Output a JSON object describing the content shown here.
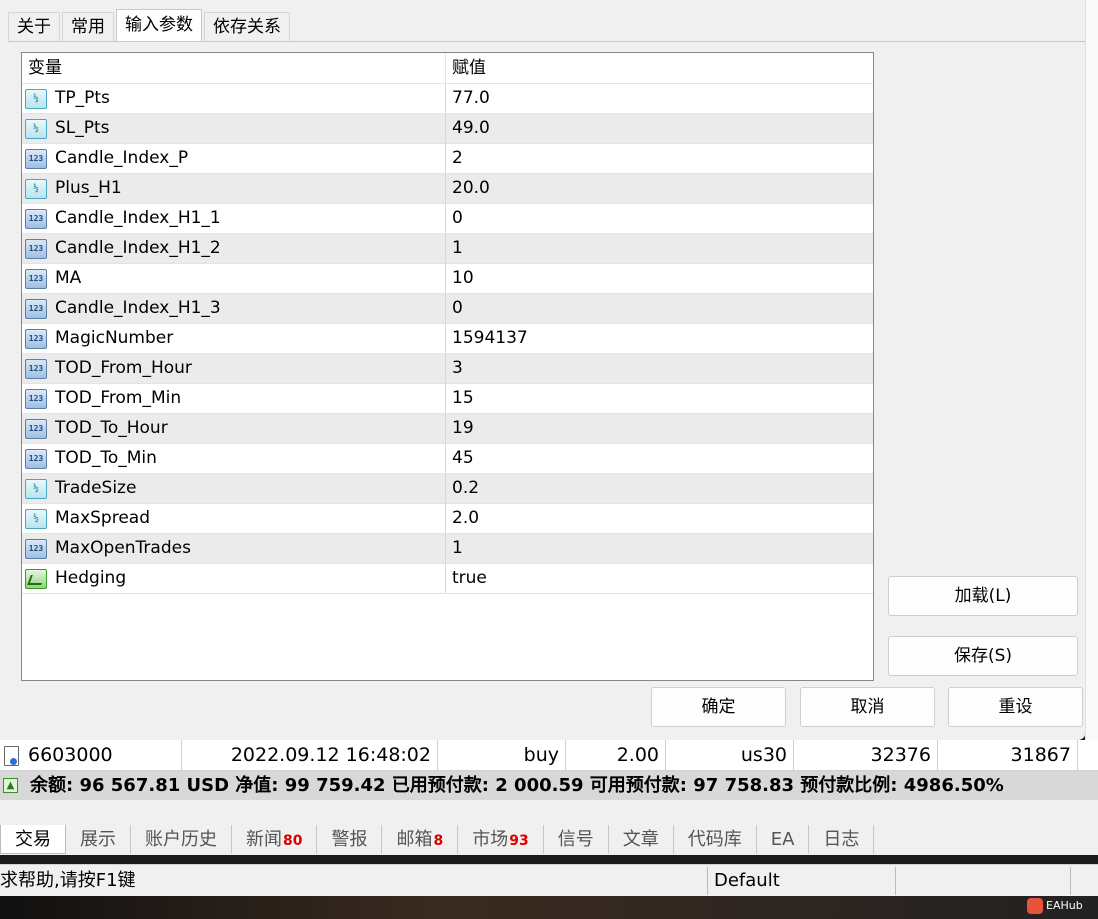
{
  "dialog": {
    "tabs": [
      "关于",
      "常用",
      "输入参数",
      "依存关系"
    ],
    "active_tab": "输入参数",
    "table": {
      "headers": [
        "变量",
        "赋值"
      ],
      "rows": [
        {
          "name": "TP_Pts",
          "value": "77.0",
          "type_icon": "double-icon"
        },
        {
          "name": "SL_Pts",
          "value": "49.0",
          "type_icon": "double-icon"
        },
        {
          "name": "Candle_Index_P",
          "value": "2",
          "type_icon": "integer-icon"
        },
        {
          "name": "Plus_H1",
          "value": "20.0",
          "type_icon": "double-icon"
        },
        {
          "name": "Candle_Index_H1_1",
          "value": "0",
          "type_icon": "integer-icon"
        },
        {
          "name": "Candle_Index_H1_2",
          "value": "1",
          "type_icon": "integer-icon"
        },
        {
          "name": "MA",
          "value": "10",
          "type_icon": "integer-icon"
        },
        {
          "name": "Candle_Index_H1_3",
          "value": "0",
          "type_icon": "integer-icon"
        },
        {
          "name": "MagicNumber",
          "value": "1594137",
          "type_icon": "integer-icon"
        },
        {
          "name": "TOD_From_Hour",
          "value": "3",
          "type_icon": "integer-icon"
        },
        {
          "name": "TOD_From_Min",
          "value": "15",
          "type_icon": "integer-icon"
        },
        {
          "name": "TOD_To_Hour",
          "value": "19",
          "type_icon": "integer-icon"
        },
        {
          "name": "TOD_To_Min",
          "value": "45",
          "type_icon": "integer-icon"
        },
        {
          "name": "TradeSize",
          "value": "0.2",
          "type_icon": "double-icon"
        },
        {
          "name": "MaxSpread",
          "value": "2.0",
          "type_icon": "double-icon"
        },
        {
          "name": "MaxOpenTrades",
          "value": "1",
          "type_icon": "integer-icon"
        },
        {
          "name": "Hedging",
          "value": "true",
          "type_icon": "boolean-icon"
        }
      ]
    },
    "buttons": {
      "load": "加载(L)",
      "save": "保存(S)",
      "ok": "确定",
      "cancel": "取消",
      "reset": "重设"
    }
  },
  "trade_row": {
    "ticket": "6603000",
    "time": "2022.09.12 16:48:02",
    "type": "buy",
    "volume": "2.00",
    "symbol": "us30",
    "price_open": "32376",
    "price_current": "31867"
  },
  "balance_line": "余额: 96 567.81 USD  净值: 99 759.42  已用预付款: 2 000.59  可用预付款: 97 758.83  预付款比例: 4986.50%",
  "bottom_tabs": [
    {
      "label": "交易",
      "badge": ""
    },
    {
      "label": "展示",
      "badge": ""
    },
    {
      "label": "账户历史",
      "badge": ""
    },
    {
      "label": "新闻",
      "badge": "80"
    },
    {
      "label": "警报",
      "badge": ""
    },
    {
      "label": "邮箱",
      "badge": "8"
    },
    {
      "label": "市场",
      "badge": "93"
    },
    {
      "label": "信号",
      "badge": ""
    },
    {
      "label": "文章",
      "badge": ""
    },
    {
      "label": "代码库",
      "badge": ""
    },
    {
      "label": "EA",
      "badge": ""
    },
    {
      "label": "日志",
      "badge": ""
    }
  ],
  "status_bar": {
    "help": "求帮助,请按F1键",
    "profile": "Default"
  },
  "watermark": "EAHub"
}
